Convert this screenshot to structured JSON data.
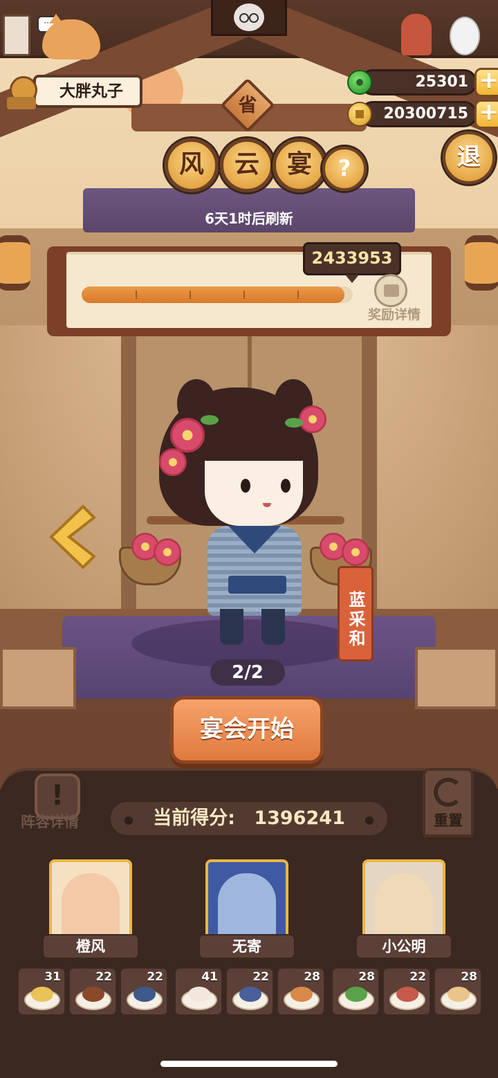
{
  "player": {
    "name": "大胖丸子"
  },
  "currencies": {
    "jade": "25301",
    "coins": "20300715",
    "plus_label": "+"
  },
  "event": {
    "province_label": "省",
    "title_chars": [
      "风",
      "云",
      "宴"
    ],
    "help_label": "?",
    "exit_label": "退",
    "refresh_text": "6天1时后刷新"
  },
  "progress": {
    "target_score": "2433953",
    "fill_fraction": 0.97,
    "reward_label": "奖励详情"
  },
  "character": {
    "name": "蓝采和",
    "pager": "2/2"
  },
  "actions": {
    "start_label": "宴会开始",
    "lineup_label": "阵容详情",
    "lineup_icon": "!",
    "reset_label": "重置"
  },
  "score": {
    "label": "当前得分:",
    "value": "1396241"
  },
  "team": [
    {
      "name": "橙风",
      "color": "#f4c9a8",
      "bg": "#f3e1c2"
    },
    {
      "name": "无寄",
      "color": "#9fb7df",
      "bg": "#3f5aa2"
    },
    {
      "name": "小公明",
      "color": "#f0d9b8",
      "bg": "#e4d6c1"
    }
  ],
  "dishes": [
    {
      "count": "31",
      "food_color": "#e9c25a"
    },
    {
      "count": "22",
      "food_color": "#8a4a2a"
    },
    {
      "count": "22",
      "food_color": "#3e5a8a"
    },
    {
      "count": "41",
      "food_color": "#f3e6dc"
    },
    {
      "count": "22",
      "food_color": "#4a5e9a"
    },
    {
      "count": "28",
      "food_color": "#d98a4a"
    },
    {
      "count": "28",
      "food_color": "#5aa24a"
    },
    {
      "count": "22",
      "food_color": "#c65a4a"
    },
    {
      "count": "28",
      "food_color": "#e8c58a"
    }
  ]
}
